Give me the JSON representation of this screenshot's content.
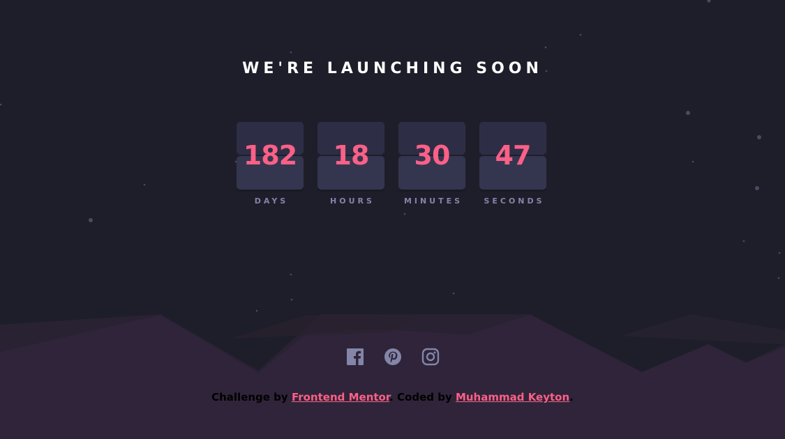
{
  "heading": "WE'RE LAUNCHING SOON",
  "countdown": [
    {
      "value": "182",
      "label": "DAYS"
    },
    {
      "value": "18",
      "label": "HOURS"
    },
    {
      "value": "30",
      "label": "MINUTES"
    },
    {
      "value": "47",
      "label": "SECONDS"
    }
  ],
  "social": {
    "icons": [
      "facebook-icon",
      "pinterest-icon",
      "instagram-icon"
    ]
  },
  "footer": {
    "challenge_prefix": "Challenge by ",
    "challenge_link": "Frontend Mentor",
    "coded_prefix": ". Coded by ",
    "coded_link": "Muhammad Keyton",
    "suffix": "."
  },
  "colors": {
    "background": "#1e1e2a",
    "card": "#343650",
    "accent": "#fb6087",
    "label": "#8385a9",
    "hills": "#2f2439",
    "icon": "#8385a9"
  }
}
